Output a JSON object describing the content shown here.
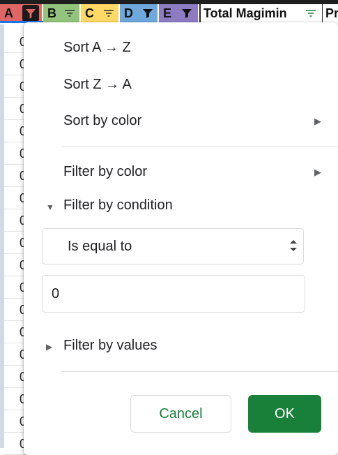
{
  "header": {
    "columns": [
      {
        "label": "A"
      },
      {
        "label": "B"
      },
      {
        "label": "C"
      },
      {
        "label": "D"
      },
      {
        "label": "E"
      },
      {
        "label": "Total Magimin"
      },
      {
        "label": "Pr"
      }
    ]
  },
  "left_cells": [
    "0",
    "0",
    "0",
    "0",
    "0",
    "0",
    "0",
    "0",
    "0",
    "0",
    "0",
    "0",
    "0",
    "0",
    "0",
    "0",
    "0",
    "0",
    "0"
  ],
  "menu": {
    "sort_az": "Sort A → Z",
    "sort_za": "Sort Z → A",
    "sort_by_color": "Sort by color",
    "filter_by_color": "Filter by color",
    "filter_by_condition": "Filter by condition",
    "condition_select": "Is equal to",
    "condition_value": "0",
    "filter_by_values": "Filter by values",
    "cancel_label": "Cancel",
    "ok_label": "OK"
  },
  "colors": {
    "accent": "#188038",
    "col_a": "#e06666",
    "col_b": "#93c47d",
    "col_c": "#ffd966",
    "col_d": "#6fa8dc",
    "col_e": "#8e7cc3"
  }
}
